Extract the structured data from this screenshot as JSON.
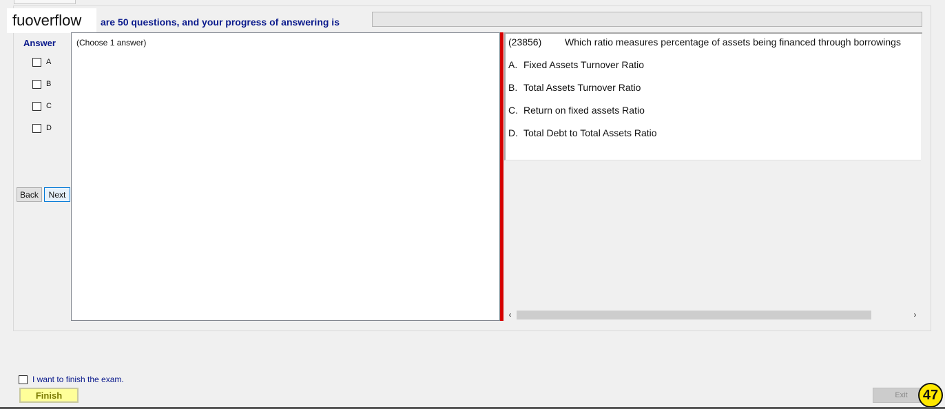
{
  "watermark": "fuoverflow",
  "progress": {
    "text": "are 50 questions, and your progress of answering is",
    "value": 0
  },
  "answer_panel": {
    "title": "Answer",
    "options": [
      "A",
      "B",
      "C",
      "D"
    ]
  },
  "nav": {
    "back_label": "Back",
    "next_label": "Next"
  },
  "answer_box": {
    "instruction": "(Choose 1 answer)"
  },
  "question": {
    "id": "(23856)",
    "text": "Which ratio measures percentage of assets being financed through borrowings",
    "choices": [
      {
        "letter": "A.",
        "text": "Fixed Assets Turnover Ratio"
      },
      {
        "letter": "B.",
        "text": "Total Assets Turnover Ratio"
      },
      {
        "letter": "C.",
        "text": "Return on fixed assets Ratio"
      },
      {
        "letter": "D.",
        "text": "Total Debt to Total Assets Ratio"
      }
    ]
  },
  "scrollbar": {
    "left_arrow": "‹",
    "right_arrow": "›"
  },
  "footer": {
    "finish_check_label": "I want to finish the exam.",
    "finish_label": "Finish",
    "exit_label": "Exit",
    "badge_number": "47"
  },
  "colors": {
    "accent_text": "#0a1a8c",
    "splitter": "#d40000",
    "finish_bg": "#ffff99",
    "badge_bg": "#ffe800"
  }
}
